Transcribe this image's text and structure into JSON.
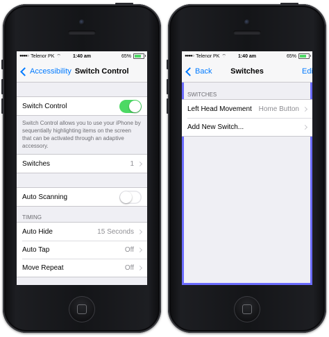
{
  "left_phone": {
    "status": {
      "carrier": "Telenor PK",
      "time": "1:40 am",
      "battery": "65%",
      "battery_level": 0.65
    },
    "nav": {
      "back_label": "Accessibility",
      "title": "Switch Control"
    },
    "switch_control": {
      "label": "Switch Control",
      "on": true
    },
    "description": "Switch Control allows you to use your iPhone by sequentially highlighting items on the screen that can be activated through an adaptive accessory.",
    "switches_row": {
      "label": "Switches",
      "value": "1"
    },
    "auto_scanning": {
      "label": "Auto Scanning",
      "on": false
    },
    "timing_header": "TIMING",
    "timing_rows": [
      {
        "label": "Auto Hide",
        "value": "15 Seconds"
      },
      {
        "label": "Auto Tap",
        "value": "Off"
      },
      {
        "label": "Move Repeat",
        "value": "Off"
      }
    ]
  },
  "right_phone": {
    "status": {
      "carrier": "Telenor PK",
      "time": "1:40 am",
      "battery": "65%",
      "battery_level": 0.65
    },
    "nav": {
      "back_label": "Back",
      "title": "Switches",
      "edit_label": "Edit"
    },
    "section_header": "SWITCHES",
    "rows": [
      {
        "label": "Left Head Movement",
        "value": "Home Button"
      },
      {
        "label": "Add New Switch...",
        "value": ""
      }
    ],
    "highlight_color": "#6b6cff"
  },
  "colors": {
    "accent": "#007aff",
    "toggle_on": "#4cd964",
    "background": "#efeff4"
  }
}
